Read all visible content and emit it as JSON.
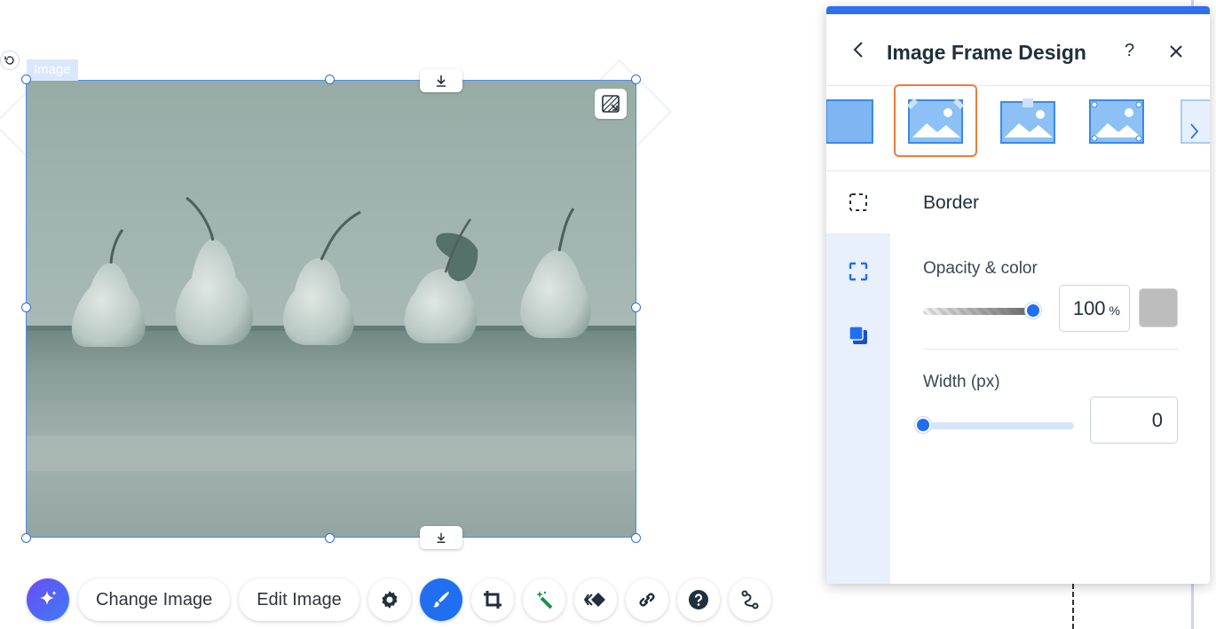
{
  "canvas": {
    "element_tag": "Image"
  },
  "toolbar": {
    "change_image_label": "Change Image",
    "edit_image_label": "Edit Image"
  },
  "panel": {
    "title": "Image Frame Design",
    "help_label": "?",
    "section_title": "Border",
    "opacity_label": "Opacity & color",
    "opacity_value": "100",
    "opacity_unit": "%",
    "opacity_fraction": 1.0,
    "border_color": "#bdbdbd",
    "width_label": "Width (px)",
    "width_value": "0",
    "width_fraction": 0.0
  },
  "colors": {
    "accent": "#1f6ff0",
    "selection": "#f07b3a",
    "panel_top": "#2f6ff0"
  }
}
